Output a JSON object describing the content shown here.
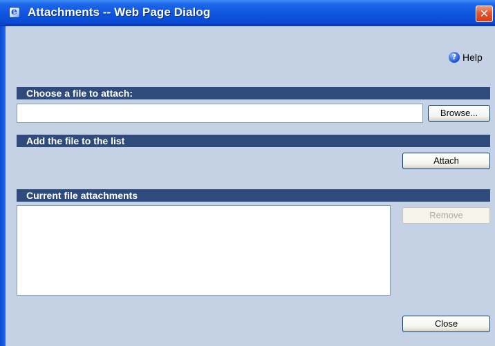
{
  "window": {
    "title": "Attachments -- Web Page Dialog",
    "close_glyph": "✕",
    "icon": "ie-page-icon",
    "colors": {
      "titlebar": "#0A4BD3",
      "background": "#C5D2E6",
      "section_header": "#2F4B7C",
      "close_button": "#D43D16"
    }
  },
  "help": {
    "label": "Help",
    "icon": "help-icon",
    "glyph": "?"
  },
  "sections": {
    "choose_file": {
      "title": "Choose a file to attach:"
    },
    "add_file": {
      "title": "Add the file to the list"
    },
    "current": {
      "title": "Current file attachments"
    }
  },
  "file_input": {
    "value": "",
    "placeholder": ""
  },
  "buttons": {
    "browse": "Browse...",
    "attach": "Attach",
    "remove": "Remove",
    "close": "Close"
  },
  "attachments": []
}
